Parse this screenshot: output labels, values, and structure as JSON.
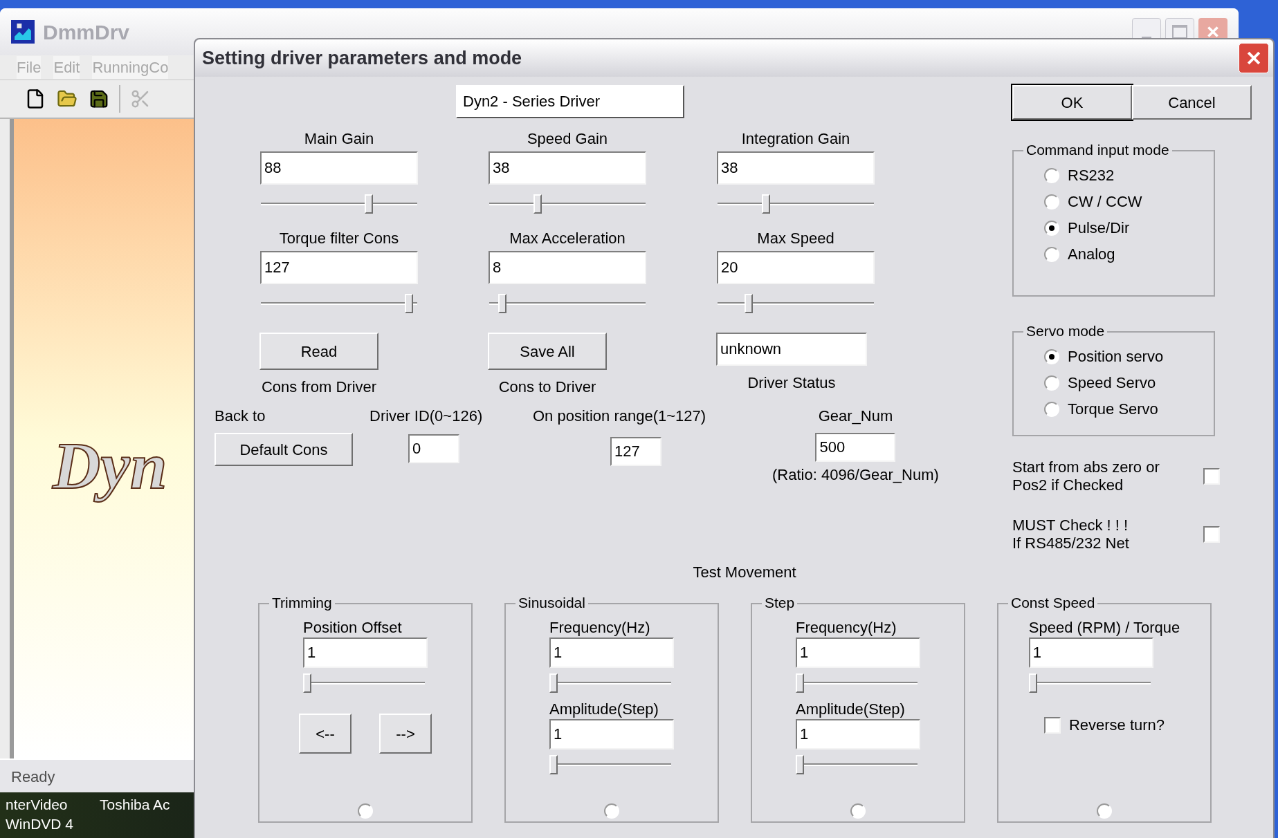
{
  "app_window": {
    "title": "DmmDrv",
    "menu": [
      "File",
      "Edit",
      "RunningCo"
    ],
    "logo_text": "Dyn",
    "status_bar": "Ready"
  },
  "taskbar": [
    {
      "lines": [
        "nterVideo",
        "WinDVD 4"
      ]
    },
    {
      "lines": [
        "Toshiba Ac"
      ]
    }
  ],
  "dialog": {
    "title": "Setting driver parameters and mode",
    "driver_name": "Dyn2 - Series Driver",
    "buttons": [
      {
        "label": "OK",
        "default": true
      },
      {
        "label": "Cancel",
        "default": false
      }
    ],
    "params": [
      {
        "label": "Main Gain",
        "value": "88",
        "level": 0.7
      },
      {
        "label": "Speed Gain",
        "value": "38",
        "level": 0.3
      },
      {
        "label": "Integration Gain",
        "value": "38",
        "level": 0.3
      },
      {
        "label": "Torque filter Cons",
        "value": "127",
        "level": 0.97
      },
      {
        "label": "Max Acceleration",
        "value": "8",
        "level": 0.06
      },
      {
        "label": "Max Speed",
        "value": "20",
        "level": 0.18
      }
    ],
    "read_button": {
      "label": "Read",
      "caption": "Cons from Driver"
    },
    "save_button": {
      "label": "Save All",
      "caption": "Cons to Driver"
    },
    "driver_status": {
      "value": "unknown",
      "caption": "Driver Status"
    },
    "default_cons": {
      "caption": "Back to",
      "label": "Default Cons"
    },
    "driver_id": {
      "label": "Driver ID(0~126)",
      "value": "0"
    },
    "position_range": {
      "label": "On position range(1~127)",
      "value": "127"
    },
    "gear_num": {
      "label": "Gear_Num",
      "value": "500",
      "note": "(Ratio: 4096/Gear_Num)"
    },
    "command_input_mode": {
      "title": "Command input mode",
      "options": [
        {
          "label": "RS232",
          "selected": false
        },
        {
          "label": "CW / CCW",
          "selected": false
        },
        {
          "label": "Pulse/Dir",
          "selected": true
        },
        {
          "label": "Analog",
          "selected": false
        }
      ]
    },
    "servo_mode": {
      "title": "Servo mode",
      "options": [
        {
          "label": "Position servo",
          "selected": true
        },
        {
          "label": "Speed Servo",
          "selected": false
        },
        {
          "label": "Torque Servo",
          "selected": false
        }
      ]
    },
    "checkboxes": [
      {
        "lines": [
          "Start from abs zero or",
          "Pos2 if Checked"
        ],
        "checked": false
      },
      {
        "lines": [
          "MUST Check ! ! !",
          "If RS485/232 Net"
        ],
        "checked": false
      }
    ],
    "test_movement": {
      "title": "Test Movement",
      "groups": [
        {
          "title": "Trimming",
          "fields": [
            {
              "label": "Position Offset",
              "value": "1",
              "level": 0
            }
          ],
          "buttons": [
            "<--",
            "-->"
          ],
          "selected": false
        },
        {
          "title": "Sinusoidal",
          "fields": [
            {
              "label": "Frequency(Hz)",
              "value": "1",
              "level": 0
            },
            {
              "label": "Amplitude(Step)",
              "value": "1",
              "level": 0
            }
          ],
          "selected": false
        },
        {
          "title": "Step",
          "fields": [
            {
              "label": "Frequency(Hz)",
              "value": "1",
              "level": 0
            },
            {
              "label": "Amplitude(Step)",
              "value": "1",
              "level": 0
            }
          ],
          "selected": false
        },
        {
          "title": "Const Speed",
          "fields": [
            {
              "label": "Speed  (RPM) / Torque",
              "value": "1",
              "level": 0
            }
          ],
          "checkbox": {
            "label": "Reverse turn?",
            "checked": false
          },
          "selected": false
        }
      ]
    }
  }
}
